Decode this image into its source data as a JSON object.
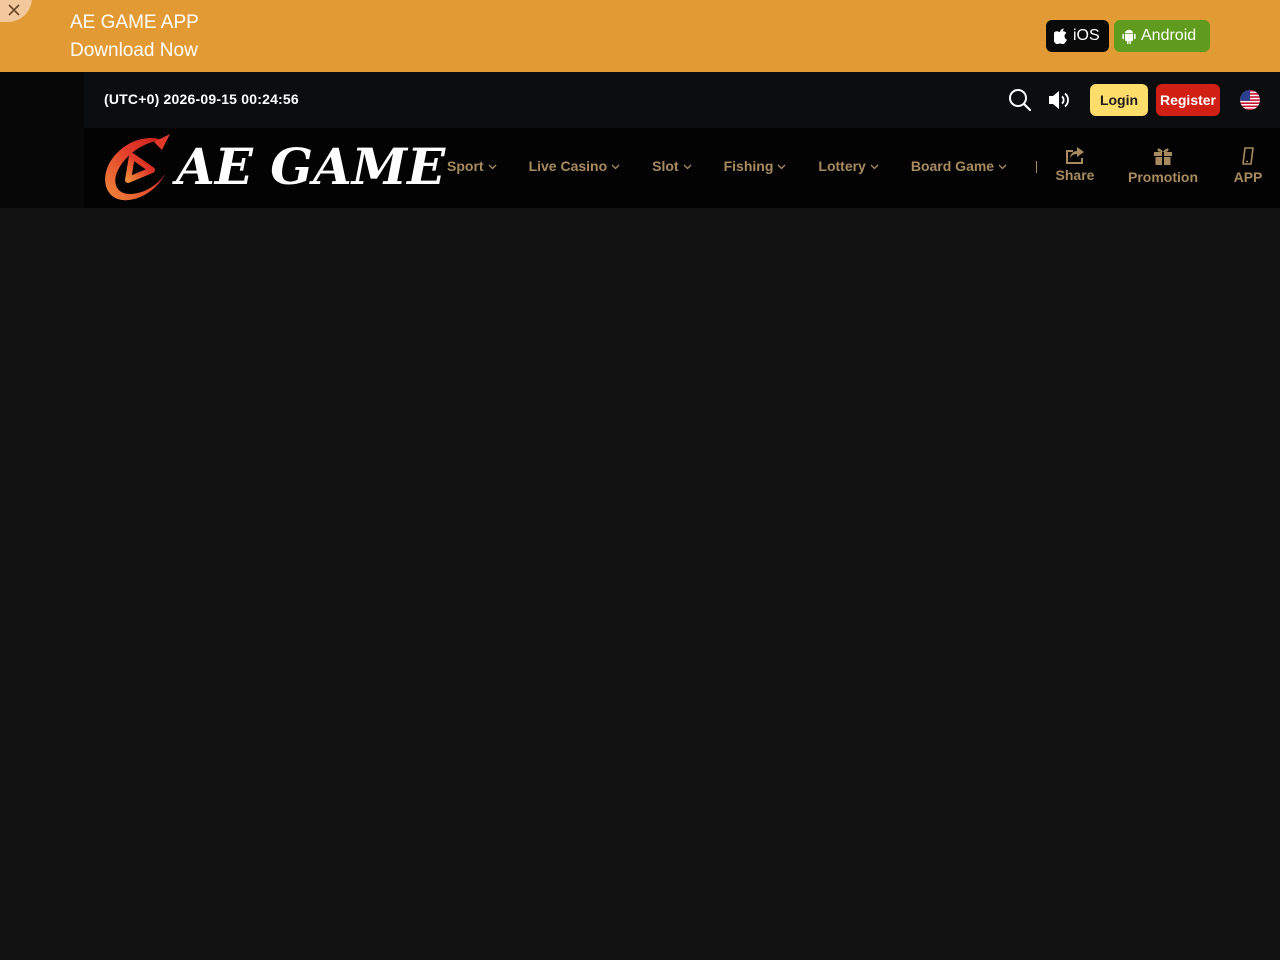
{
  "banner": {
    "line1": "AE GAME APP",
    "line2": "Download Now",
    "ios_label": "iOS",
    "android_label": "Android",
    "bg_color": "#e29a34"
  },
  "topbar": {
    "clock": "(UTC+0) 2026-09-15 00:24:56",
    "login_label": "Login",
    "register_label": "Register"
  },
  "logo": {
    "text": "AE GAME"
  },
  "nav": {
    "items": [
      {
        "label": "Sport"
      },
      {
        "label": "Live Casino"
      },
      {
        "label": "Slot"
      },
      {
        "label": "Fishing"
      },
      {
        "label": "Lottery"
      },
      {
        "label": "Board Game"
      }
    ],
    "share_label": "Share",
    "promotion_label": "Promotion",
    "app_label": "APP"
  },
  "colors": {
    "accent_gold": "#a88a5f",
    "login_yellow": "#ffdd6b",
    "register_red": "#d11f14",
    "android_green": "#5f9b1d"
  },
  "icons": [
    "close-icon",
    "apple-icon",
    "android-icon",
    "search-icon",
    "speaker-icon",
    "us-flag-icon",
    "chevron-down-icon",
    "share-icon",
    "gift-icon",
    "phone-icon"
  ]
}
